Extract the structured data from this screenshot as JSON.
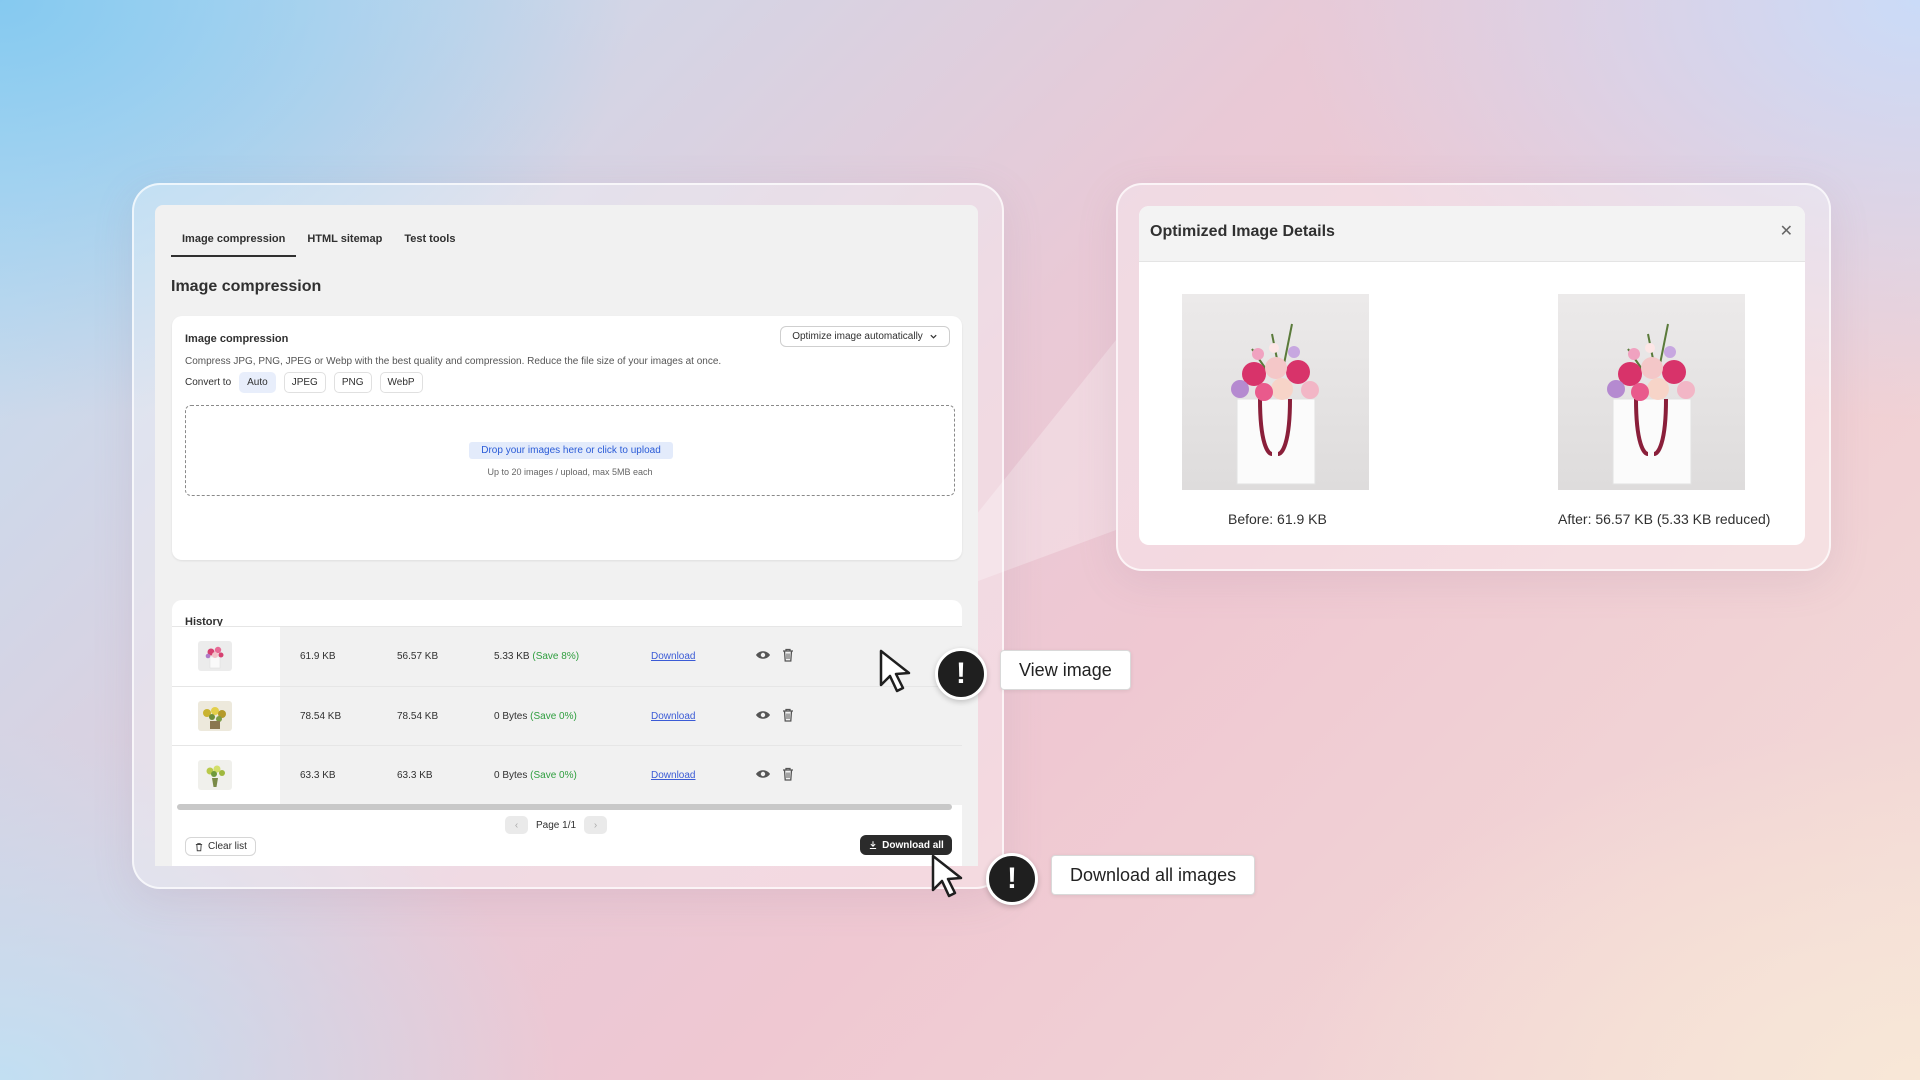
{
  "tabs": [
    {
      "label": "Image compression"
    },
    {
      "label": "HTML sitemap"
    },
    {
      "label": "Test tools"
    }
  ],
  "page_title": "Image compression",
  "compress_card": {
    "title": "Image compression",
    "optimize_select": "Optimize image automatically",
    "description": "Compress JPG, PNG, JPEG or Webp with the best quality and compression. Reduce the file size of your images at once.",
    "convert_label": "Convert to",
    "formats": [
      "Auto",
      "JPEG",
      "PNG",
      "WebP"
    ],
    "selected_format": "Auto",
    "drop_button": "Drop your images here or click to upload",
    "drop_hint": "Up to 20 images / upload, max 5MB each"
  },
  "history": {
    "title": "History",
    "rows": [
      {
        "before": "61.9 KB",
        "after": "56.57 KB",
        "saved": "5.33 KB",
        "save_pct": "(Save 8%)",
        "download": "Download"
      },
      {
        "before": "78.54 KB",
        "after": "78.54 KB",
        "saved": "0 Bytes",
        "save_pct": "(Save 0%)",
        "download": "Download"
      },
      {
        "before": "63.3 KB",
        "after": "63.3 KB",
        "saved": "0 Bytes",
        "save_pct": "(Save 0%)",
        "download": "Download"
      }
    ],
    "page_label": "Page 1/1",
    "clear_label": "Clear list",
    "download_all_label": "Download all"
  },
  "modal": {
    "title": "Optimized Image Details",
    "close_icon": "close-icon",
    "before_caption": "Before: 61.9 KB",
    "after_caption": "After: 56.57 KB (5.33 KB reduced)"
  },
  "callouts": {
    "view_image": "View image",
    "download_all_images": "Download all images"
  },
  "colors": {
    "save_green": "#2e9e3e",
    "link_blue": "#3b5bd6",
    "primary_dark": "#2b2b2b"
  }
}
